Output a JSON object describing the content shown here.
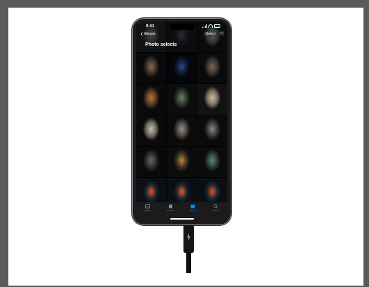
{
  "status_bar": {
    "time": "9:41"
  },
  "nav": {
    "back_label": "Albums",
    "select_label": "Select",
    "more_label": "···"
  },
  "album": {
    "title": "Photo selects"
  },
  "photos": [
    {
      "name": "photo-model-feather-headpiece",
      "colors": [
        "#2a2a2c",
        "#4a3f36",
        "#121214"
      ]
    },
    {
      "name": "photo-abstract-blur",
      "colors": [
        "#141418",
        "#2b2c3a",
        "#0d0d10"
      ]
    },
    {
      "name": "photo-iridescent-dark",
      "colors": [
        "#2c3a3c",
        "#6a4a3a",
        "#0b0b0d"
      ]
    },
    {
      "name": "photo-portrait-woman-dark",
      "colors": [
        "#3a3028",
        "#8a6a55",
        "#08090a"
      ]
    },
    {
      "name": "photo-blue-bird",
      "colors": [
        "#0f1a33",
        "#2a4a8a",
        "#05060a"
      ]
    },
    {
      "name": "photo-portrait-feathers",
      "colors": [
        "#3c3430",
        "#7a6656",
        "#0a0a0b"
      ]
    },
    {
      "name": "photo-woman-with-flowers",
      "colors": [
        "#5a3a22",
        "#b07a40",
        "#0a0a0a"
      ]
    },
    {
      "name": "photo-woman-standing-green",
      "colors": [
        "#2d3a2e",
        "#6f7d62",
        "#0c0d0b"
      ]
    },
    {
      "name": "photo-woman-beige-coat",
      "colors": [
        "#7c7160",
        "#c9bca4",
        "#121212"
      ]
    },
    {
      "name": "photo-woman-light-suit",
      "colors": [
        "#6f6a60",
        "#c8c0b0",
        "#0a0a0a"
      ]
    },
    {
      "name": "photo-woman-feather-cape",
      "colors": [
        "#4a4442",
        "#9a8f85",
        "#0b0b0b"
      ]
    },
    {
      "name": "photo-owl-grey",
      "colors": [
        "#3b3936",
        "#8c857b",
        "#0a0a0a"
      ]
    },
    {
      "name": "photo-hooded-figure",
      "colors": [
        "#2e2e2e",
        "#6a6a6a",
        "#0a0a0a"
      ]
    },
    {
      "name": "photo-owl-eye-closeup",
      "colors": [
        "#3a3228",
        "#c68a2a",
        "#0e0c0a"
      ]
    },
    {
      "name": "photo-woman-teal-shawl",
      "colors": [
        "#2a3a3a",
        "#5f8580",
        "#0a0b0b"
      ]
    },
    {
      "name": "photo-woman-orange-ruffles-1",
      "colors": [
        "#1c2a33",
        "#e8551a",
        "#0a0f14"
      ]
    },
    {
      "name": "photo-woman-orange-ruffles-2",
      "colors": [
        "#1c2a33",
        "#f0591c",
        "#0a0f14"
      ]
    },
    {
      "name": "photo-woman-orange-ruffles-3",
      "colors": [
        "#1c2a33",
        "#ea5219",
        "#0a0f14"
      ]
    }
  ],
  "tabbar": {
    "items": [
      {
        "label": "Library",
        "icon": "photo-library-icon",
        "active": false
      },
      {
        "label": "For You",
        "icon": "for-you-icon",
        "active": false
      },
      {
        "label": "Albums",
        "icon": "albums-icon",
        "active": true
      },
      {
        "label": "Search",
        "icon": "search-icon",
        "active": false
      }
    ]
  },
  "colors": {
    "accent": "#0a84ff",
    "canvas": "#ffffff",
    "frame": "#5a5a5a",
    "battery": "#3bd14a"
  }
}
